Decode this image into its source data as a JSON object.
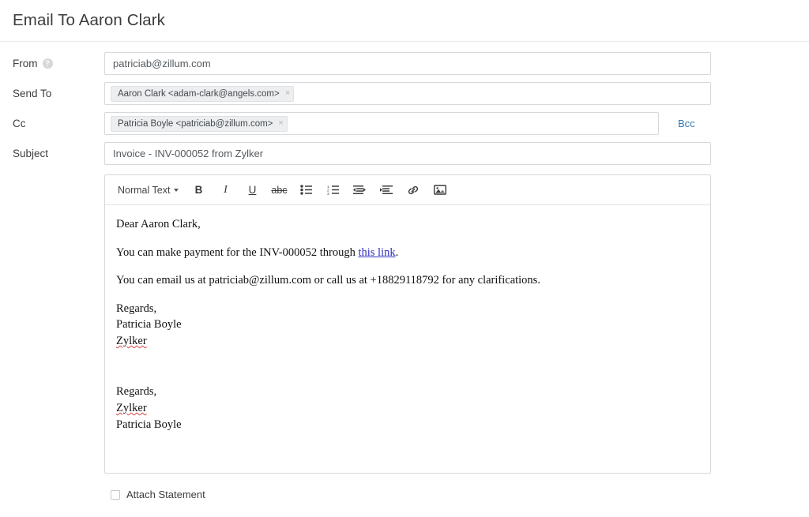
{
  "header": {
    "title": "Email To Aaron Clark"
  },
  "form": {
    "from": {
      "label": "From",
      "help_icon": "help-circle-icon",
      "value": "patriciab@zillum.com"
    },
    "send_to": {
      "label": "Send To",
      "chip": "Aaron Clark <adam-clark@angels.com>",
      "chip_close": "×"
    },
    "cc": {
      "label": "Cc",
      "chip": "Patricia Boyle <patriciab@zillum.com>",
      "chip_close": "×",
      "bcc_label": "Bcc"
    },
    "subject": {
      "label": "Subject",
      "value": "Invoice - INV-000052 from Zylker"
    }
  },
  "editor": {
    "toolbar": {
      "style_label": "Normal Text",
      "bold": "B",
      "italic": "I",
      "underline": "U",
      "strikethrough": "abc",
      "icons": [
        "bulleted-list-icon",
        "numbered-list-icon",
        "outdent-icon",
        "indent-icon",
        "link-icon",
        "image-icon"
      ]
    },
    "body": {
      "greeting": "Dear Aaron Clark,",
      "line2_before_link": "You can make payment for the INV-000052 through ",
      "line2_link": "this link",
      "line2_after_link": ".",
      "line3": "You can email us at patriciab@zillum.com or call us at +18829118792 for any clarifications.",
      "signature1": {
        "l1": "Regards,",
        "l2": "Patricia Boyle",
        "l3": "Zylker"
      },
      "signature2": {
        "l1": "Regards,",
        "l2": "Zylker",
        "l3": "Patricia Boyle"
      }
    }
  },
  "attach": {
    "label": "Attach Statement",
    "checked": false
  },
  "colors": {
    "link": "#2e7ab8",
    "body_link": "#2f2fbe",
    "border": "#d5d8dc",
    "chip_bg": "#eceef0",
    "spellcheck": "#d24545"
  }
}
